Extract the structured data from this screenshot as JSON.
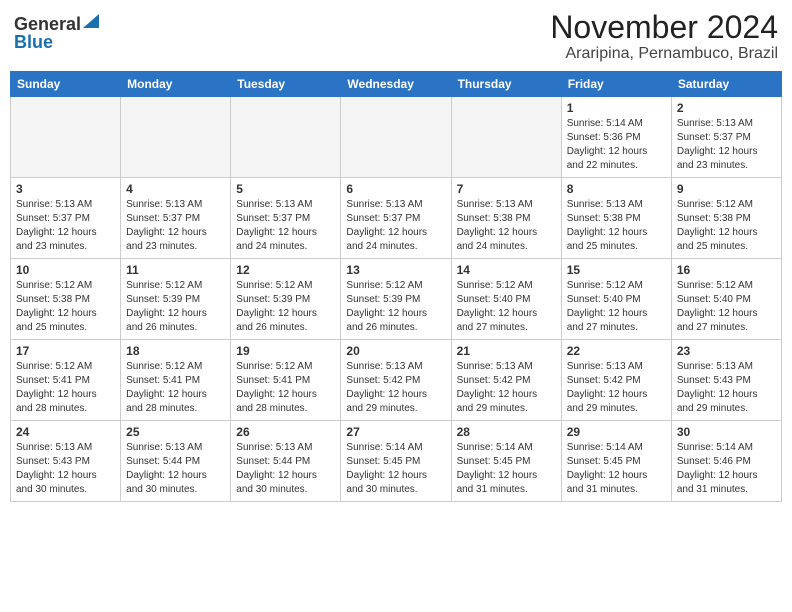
{
  "header": {
    "logo_general": "General",
    "logo_blue": "Blue",
    "month_title": "November 2024",
    "location": "Araripina, Pernambuco, Brazil"
  },
  "calendar": {
    "weekdays": [
      "Sunday",
      "Monday",
      "Tuesday",
      "Wednesday",
      "Thursday",
      "Friday",
      "Saturday"
    ],
    "weeks": [
      [
        {
          "day": "",
          "info": ""
        },
        {
          "day": "",
          "info": ""
        },
        {
          "day": "",
          "info": ""
        },
        {
          "day": "",
          "info": ""
        },
        {
          "day": "",
          "info": ""
        },
        {
          "day": "1",
          "info": "Sunrise: 5:14 AM\nSunset: 5:36 PM\nDaylight: 12 hours and 22 minutes."
        },
        {
          "day": "2",
          "info": "Sunrise: 5:13 AM\nSunset: 5:37 PM\nDaylight: 12 hours and 23 minutes."
        }
      ],
      [
        {
          "day": "3",
          "info": "Sunrise: 5:13 AM\nSunset: 5:37 PM\nDaylight: 12 hours and 23 minutes."
        },
        {
          "day": "4",
          "info": "Sunrise: 5:13 AM\nSunset: 5:37 PM\nDaylight: 12 hours and 23 minutes."
        },
        {
          "day": "5",
          "info": "Sunrise: 5:13 AM\nSunset: 5:37 PM\nDaylight: 12 hours and 24 minutes."
        },
        {
          "day": "6",
          "info": "Sunrise: 5:13 AM\nSunset: 5:37 PM\nDaylight: 12 hours and 24 minutes."
        },
        {
          "day": "7",
          "info": "Sunrise: 5:13 AM\nSunset: 5:38 PM\nDaylight: 12 hours and 24 minutes."
        },
        {
          "day": "8",
          "info": "Sunrise: 5:13 AM\nSunset: 5:38 PM\nDaylight: 12 hours and 25 minutes."
        },
        {
          "day": "9",
          "info": "Sunrise: 5:12 AM\nSunset: 5:38 PM\nDaylight: 12 hours and 25 minutes."
        }
      ],
      [
        {
          "day": "10",
          "info": "Sunrise: 5:12 AM\nSunset: 5:38 PM\nDaylight: 12 hours and 25 minutes."
        },
        {
          "day": "11",
          "info": "Sunrise: 5:12 AM\nSunset: 5:39 PM\nDaylight: 12 hours and 26 minutes."
        },
        {
          "day": "12",
          "info": "Sunrise: 5:12 AM\nSunset: 5:39 PM\nDaylight: 12 hours and 26 minutes."
        },
        {
          "day": "13",
          "info": "Sunrise: 5:12 AM\nSunset: 5:39 PM\nDaylight: 12 hours and 26 minutes."
        },
        {
          "day": "14",
          "info": "Sunrise: 5:12 AM\nSunset: 5:40 PM\nDaylight: 12 hours and 27 minutes."
        },
        {
          "day": "15",
          "info": "Sunrise: 5:12 AM\nSunset: 5:40 PM\nDaylight: 12 hours and 27 minutes."
        },
        {
          "day": "16",
          "info": "Sunrise: 5:12 AM\nSunset: 5:40 PM\nDaylight: 12 hours and 27 minutes."
        }
      ],
      [
        {
          "day": "17",
          "info": "Sunrise: 5:12 AM\nSunset: 5:41 PM\nDaylight: 12 hours and 28 minutes."
        },
        {
          "day": "18",
          "info": "Sunrise: 5:12 AM\nSunset: 5:41 PM\nDaylight: 12 hours and 28 minutes."
        },
        {
          "day": "19",
          "info": "Sunrise: 5:12 AM\nSunset: 5:41 PM\nDaylight: 12 hours and 28 minutes."
        },
        {
          "day": "20",
          "info": "Sunrise: 5:13 AM\nSunset: 5:42 PM\nDaylight: 12 hours and 29 minutes."
        },
        {
          "day": "21",
          "info": "Sunrise: 5:13 AM\nSunset: 5:42 PM\nDaylight: 12 hours and 29 minutes."
        },
        {
          "day": "22",
          "info": "Sunrise: 5:13 AM\nSunset: 5:42 PM\nDaylight: 12 hours and 29 minutes."
        },
        {
          "day": "23",
          "info": "Sunrise: 5:13 AM\nSunset: 5:43 PM\nDaylight: 12 hours and 29 minutes."
        }
      ],
      [
        {
          "day": "24",
          "info": "Sunrise: 5:13 AM\nSunset: 5:43 PM\nDaylight: 12 hours and 30 minutes."
        },
        {
          "day": "25",
          "info": "Sunrise: 5:13 AM\nSunset: 5:44 PM\nDaylight: 12 hours and 30 minutes."
        },
        {
          "day": "26",
          "info": "Sunrise: 5:13 AM\nSunset: 5:44 PM\nDaylight: 12 hours and 30 minutes."
        },
        {
          "day": "27",
          "info": "Sunrise: 5:14 AM\nSunset: 5:45 PM\nDaylight: 12 hours and 30 minutes."
        },
        {
          "day": "28",
          "info": "Sunrise: 5:14 AM\nSunset: 5:45 PM\nDaylight: 12 hours and 31 minutes."
        },
        {
          "day": "29",
          "info": "Sunrise: 5:14 AM\nSunset: 5:45 PM\nDaylight: 12 hours and 31 minutes."
        },
        {
          "day": "30",
          "info": "Sunrise: 5:14 AM\nSunset: 5:46 PM\nDaylight: 12 hours and 31 minutes."
        }
      ]
    ]
  }
}
